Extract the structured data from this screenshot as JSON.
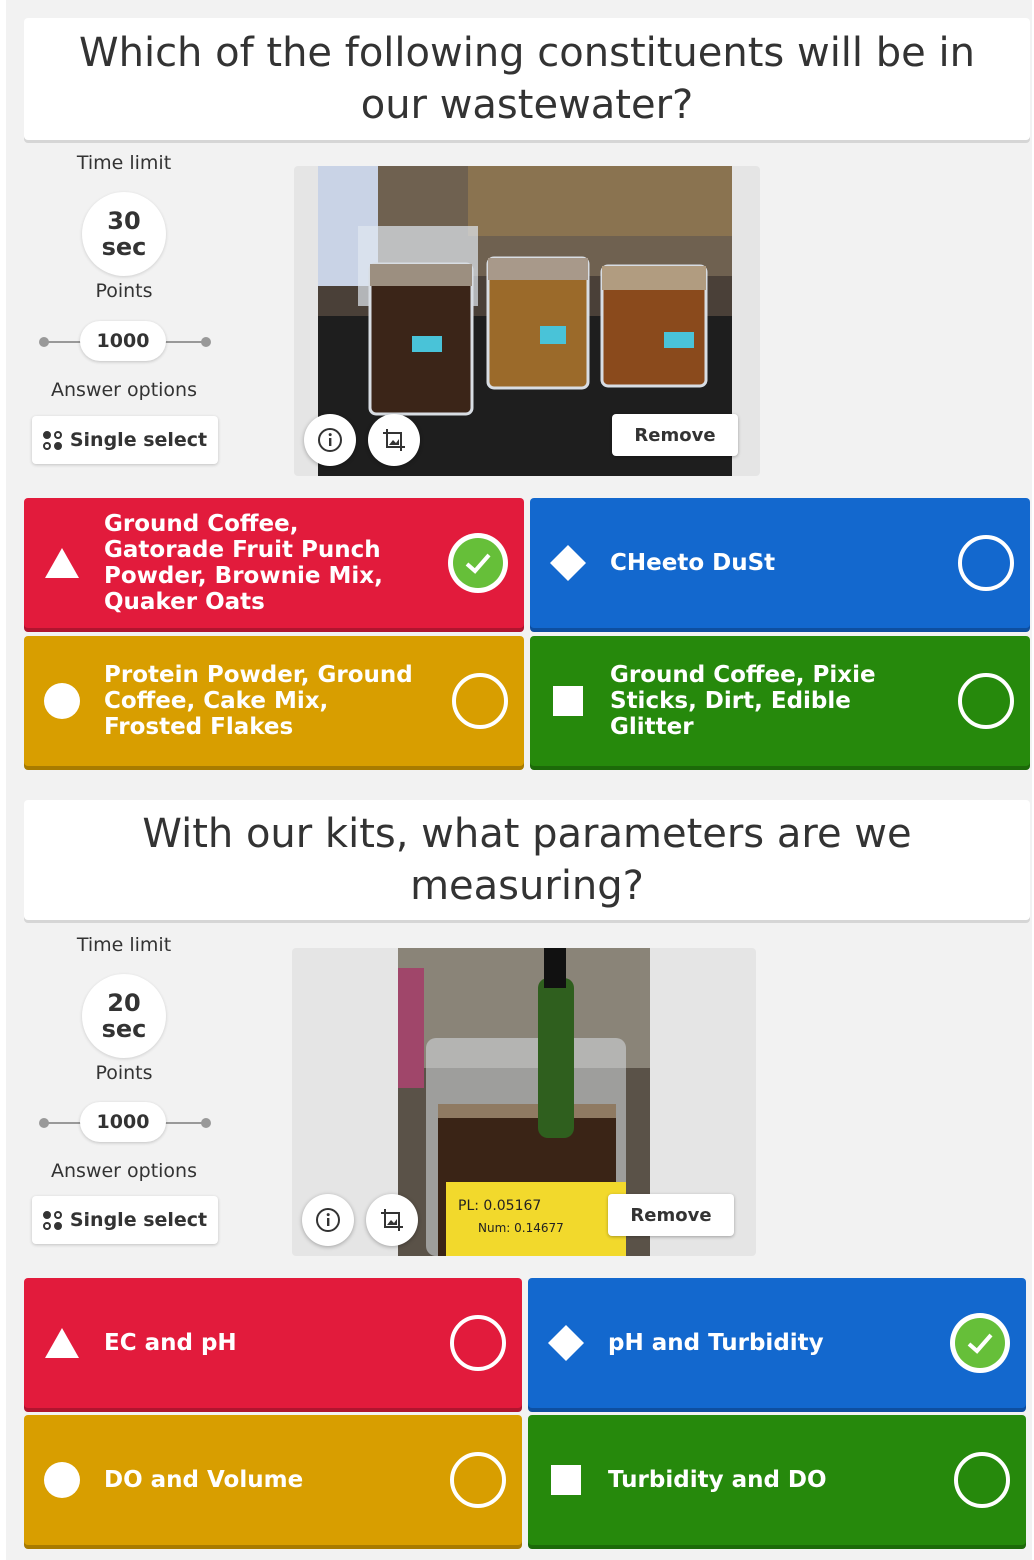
{
  "questions": [
    {
      "title": "Which of the following constituents will be in our wastewater?",
      "settings": {
        "time_limit_label": "Time limit",
        "time_value": "30",
        "time_unit": "sec",
        "points_label": "Points",
        "points_value": "1000",
        "answer_options_label": "Answer options",
        "answer_type": "Single select"
      },
      "media": {
        "remove_label": "Remove",
        "info_icon": "info-icon",
        "crop_icon": "crop-icon"
      },
      "answers": [
        {
          "shape": "triangle",
          "color": "#e21b3c",
          "text": "Ground Coffee, Gatorade Fruit Punch Powder, Brownie Mix, Quaker Oats",
          "correct": true
        },
        {
          "shape": "diamond",
          "color": "#1368ce",
          "text": "CHeeto DuSt",
          "correct": false
        },
        {
          "shape": "circle",
          "color": "#d89e00",
          "text": "Protein Powder, Ground Coffee, Cake Mix, Frosted Flakes",
          "correct": false
        },
        {
          "shape": "square",
          "color": "#26890c",
          "text": "Ground Coffee, Pixie Sticks, Dirt, Edible Glitter",
          "correct": false
        }
      ]
    },
    {
      "title": "With our kits, what parameters are we measuring?",
      "settings": {
        "time_limit_label": "Time limit",
        "time_value": "20",
        "time_unit": "sec",
        "points_label": "Points",
        "points_value": "1000",
        "answer_options_label": "Answer options",
        "answer_type": "Single select"
      },
      "media": {
        "remove_label": "Remove",
        "info_icon": "info-icon",
        "crop_icon": "crop-icon",
        "photo_label_1": "PL: 0.05167",
        "photo_label_2": "Num: 0.14677"
      },
      "answers": [
        {
          "shape": "triangle",
          "color": "#e21b3c",
          "text": "EC and pH",
          "correct": false
        },
        {
          "shape": "diamond",
          "color": "#1368ce",
          "text": "pH and Turbidity",
          "correct": true
        },
        {
          "shape": "circle",
          "color": "#d89e00",
          "text": "DO and Volume",
          "correct": false
        },
        {
          "shape": "square",
          "color": "#26890c",
          "text": "Turbidity and DO",
          "correct": false
        }
      ]
    }
  ]
}
